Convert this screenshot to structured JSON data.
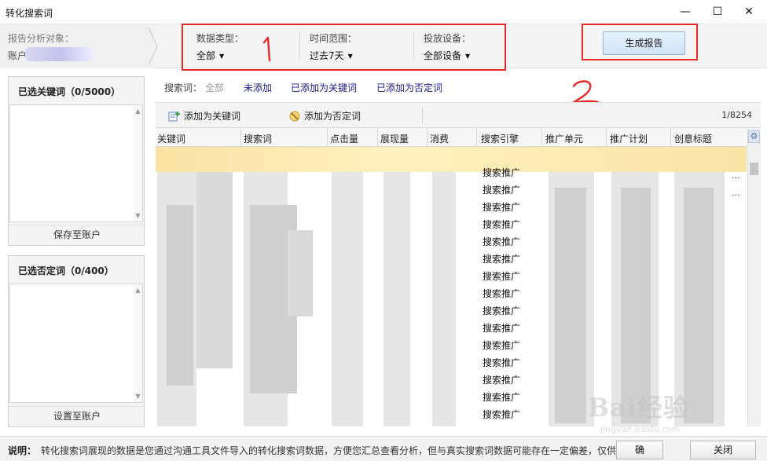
{
  "window": {
    "title": "转化搜索词",
    "minimize": "—",
    "maximize": "☐",
    "close": "✕"
  },
  "filters": {
    "target_label": "报告分析对象：",
    "target_account": "账户",
    "data_type": {
      "label": "数据类型：",
      "value": "全部"
    },
    "time_range": {
      "label": "时间范围：",
      "value": "过去7天"
    },
    "device": {
      "label": "投放设备：",
      "value": "全部设备"
    },
    "generate_button": "生成报告"
  },
  "annotations": {
    "box1_number": "1",
    "box2_number": "2",
    "color": "#e8282a"
  },
  "selected_keywords": {
    "title": "已选关键词（0/5000）",
    "footer_button": "保存至账户"
  },
  "selected_negatives": {
    "title": "已选否定词（0/400）",
    "footer_button": "设置至账户"
  },
  "search_filter": {
    "label": "搜索词：",
    "all": "全部",
    "not_added": "未添加",
    "added_keyword": "已添加为关键词",
    "added_negative": "已添加为否定词"
  },
  "toolbar": {
    "add_keyword": "添加为关键词",
    "add_negative": "添加为否定词",
    "pagination": "1/8254"
  },
  "table": {
    "columns": [
      "关键词",
      "搜索词",
      "点击量",
      "展现量",
      "消费",
      "搜索引擎",
      "推广单元",
      "推广计划",
      "创意标题"
    ],
    "engine_values": [
      "搜索推广",
      "搜索推广",
      "搜索推广",
      "搜索推广",
      "搜索推广",
      "搜索推广",
      "搜索推广",
      "搜索推广",
      "搜索推广",
      "搜索推广",
      "搜索推广",
      "搜索推广",
      "搜索推广",
      "搜索推广",
      "搜索推广"
    ],
    "more_indicator": "..."
  },
  "status": {
    "note_label": "说明：",
    "note": "转化搜索词展现的数据是您通过沟通工具文件导入的转化搜索词数据，方便您汇总查看分析，但与真实搜索词数据可能存在一定偏差，仅供参考。",
    "ok_button": "确",
    "close_button": "关闭"
  },
  "watermark": {
    "brand": "Bai经验",
    "url": "jingyan.baidu.com"
  }
}
